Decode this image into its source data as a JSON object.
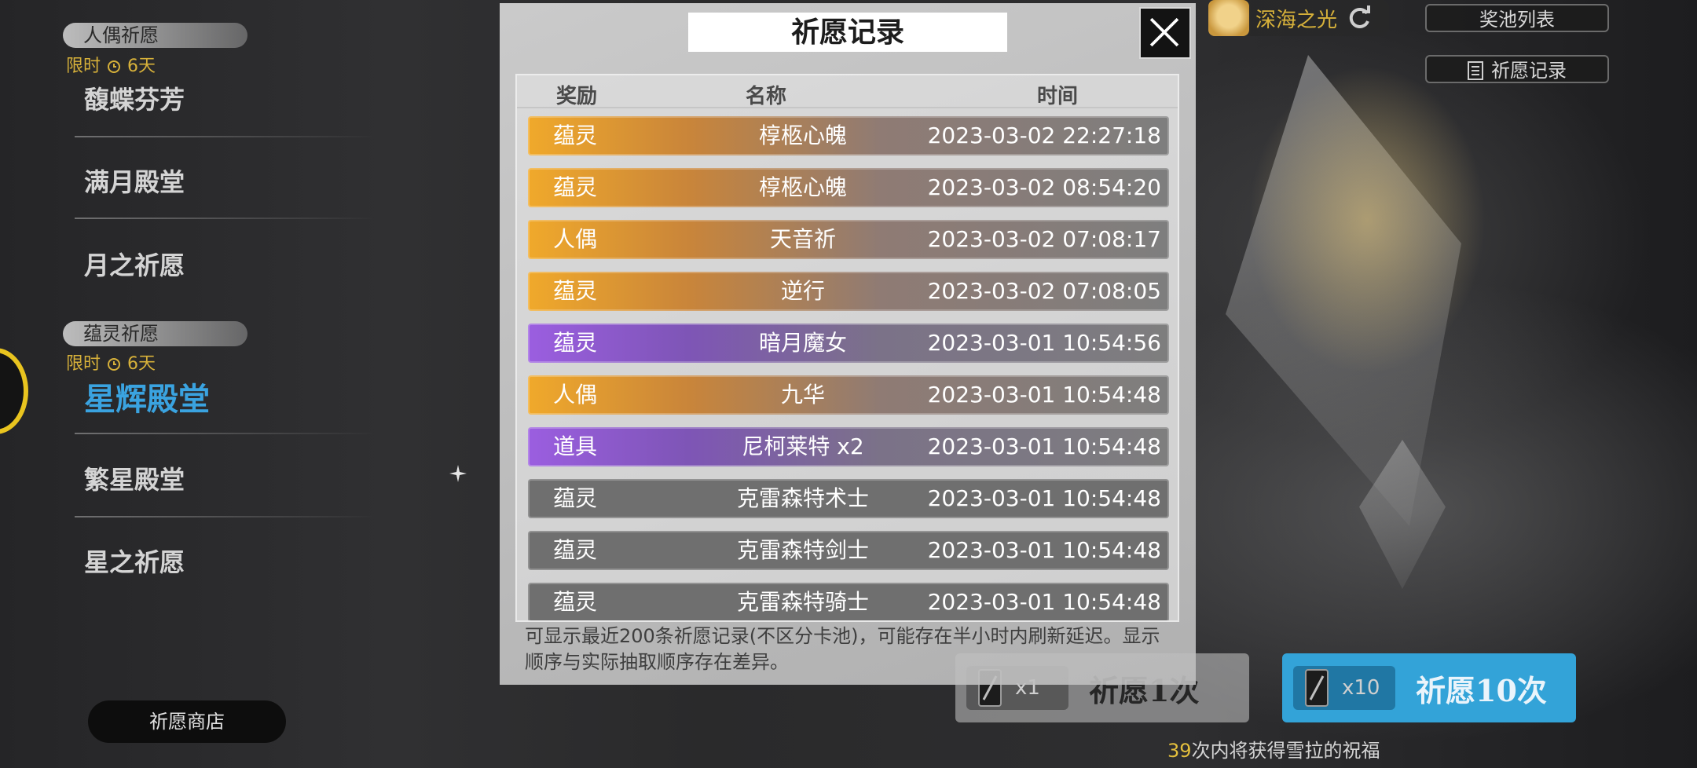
{
  "left_menu": {
    "group1": {
      "tag": "人偶祈愿",
      "limit_label": "限时",
      "limit_days": "6天",
      "items": [
        "馥蝶芬芳",
        "满月殿堂",
        "月之祈愿"
      ]
    },
    "group2": {
      "tag": "蕴灵祈愿",
      "limit_label": "限时",
      "limit_days": "6天",
      "items": [
        "星辉殿堂",
        "繁星殿堂",
        "星之祈愿"
      ],
      "active_item": "星辉殿堂"
    },
    "shop_button": "祈愿商店"
  },
  "top_right": {
    "character_name": "深海之光",
    "pool_list_button": "奖池列表",
    "history_button": "祈愿记录"
  },
  "bottom_right": {
    "pull_one": {
      "count": "x1",
      "label": "祈愿1次"
    },
    "pull_ten": {
      "count": "x10",
      "label": "祈愿10次"
    },
    "pity": {
      "number": "39",
      "text": "次内将获得雪拉的祝福"
    }
  },
  "modal": {
    "title": "祈愿记录",
    "columns": {
      "reward": "奖励",
      "name": "名称",
      "time": "时间"
    },
    "rows": [
      {
        "type": "蕴灵",
        "name": "椁柩心魄",
        "time": "2023-03-02 22:27:18",
        "rarity": "gold"
      },
      {
        "type": "蕴灵",
        "name": "椁柩心魄",
        "time": "2023-03-02 08:54:20",
        "rarity": "gold"
      },
      {
        "type": "人偶",
        "name": "天音祈",
        "time": "2023-03-02 07:08:17",
        "rarity": "gold"
      },
      {
        "type": "蕴灵",
        "name": "逆行",
        "time": "2023-03-02 07:08:05",
        "rarity": "gold"
      },
      {
        "type": "蕴灵",
        "name": "暗月魔女",
        "time": "2023-03-01 10:54:56",
        "rarity": "purple"
      },
      {
        "type": "人偶",
        "name": "九华",
        "time": "2023-03-01 10:54:48",
        "rarity": "gold"
      },
      {
        "type": "道具",
        "name": "尼柯莱特 x2",
        "time": "2023-03-01 10:54:48",
        "rarity": "purple"
      },
      {
        "type": "蕴灵",
        "name": "克雷森特术士",
        "time": "2023-03-01 10:54:48",
        "rarity": "gray"
      },
      {
        "type": "蕴灵",
        "name": "克雷森特剑士",
        "time": "2023-03-01 10:54:48",
        "rarity": "gray"
      },
      {
        "type": "蕴灵",
        "name": "克雷森特骑士",
        "time": "2023-03-01 10:54:48",
        "rarity": "gray"
      }
    ],
    "note": "可显示最近200条祈愿记录(不区分卡池)，可能存在半小时内刷新延迟。显示顺序与实际抽取顺序存在差异。"
  },
  "colors": {
    "gold": "#f0a92b",
    "purple": "#9b5ee0",
    "gray": "#6f6f6f",
    "accent_blue": "#33a3d8",
    "active_text": "#3aa3e0",
    "limit_text": "#d7b13a"
  },
  "icons": [
    "clock-icon",
    "refresh-icon",
    "document-icon",
    "close-icon",
    "ticket-icon",
    "sparkle-icon"
  ]
}
